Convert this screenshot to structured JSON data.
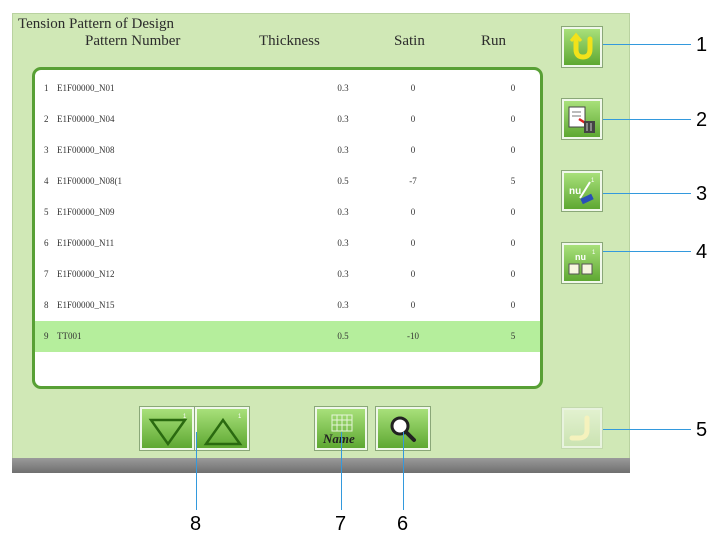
{
  "panel": {
    "title": "Tension Pattern of Design",
    "headers": {
      "pattern_number": "Pattern Number",
      "thickness": "Thickness",
      "satin": "Satin",
      "run": "Run"
    }
  },
  "rows": [
    {
      "index": "1",
      "name": "E1F00000_N01",
      "thickness": "0.3",
      "satin": "0",
      "run": "0"
    },
    {
      "index": "2",
      "name": "E1F00000_N04",
      "thickness": "0.3",
      "satin": "0",
      "run": "0"
    },
    {
      "index": "3",
      "name": "E1F00000_N08",
      "thickness": "0.3",
      "satin": "0",
      "run": "0"
    },
    {
      "index": "4",
      "name": "E1F00000_N08(1",
      "thickness": "0.5",
      "satin": "-7",
      "run": "5"
    },
    {
      "index": "5",
      "name": "E1F00000_N09",
      "thickness": "0.3",
      "satin": "0",
      "run": "0"
    },
    {
      "index": "6",
      "name": "E1F00000_N11",
      "thickness": "0.3",
      "satin": "0",
      "run": "0"
    },
    {
      "index": "7",
      "name": "E1F00000_N12",
      "thickness": "0.3",
      "satin": "0",
      "run": "0"
    },
    {
      "index": "8",
      "name": "E1F00000_N15",
      "thickness": "0.3",
      "satin": "0",
      "run": "0"
    },
    {
      "index": "9",
      "name": "TT001",
      "thickness": "0.5",
      "satin": "-10",
      "run": "5"
    }
  ],
  "selected_row_index": "9",
  "buttons": {
    "back": {
      "icon": "return-arrow-icon"
    },
    "delete": {
      "icon": "delete-trash-icon"
    },
    "edit": {
      "icon": "edit-pencil-icon"
    },
    "copy": {
      "icon": "copy-pattern-icon"
    },
    "confirm": {
      "icon": "return-arrow-icon",
      "state": "disabled"
    },
    "scroll_down": {
      "icon": "triangle-down-icon"
    },
    "scroll_up": {
      "icon": "triangle-up-icon"
    },
    "name": {
      "label": "Name",
      "icon": "name-grid-icon"
    },
    "search": {
      "icon": "magnifier-icon"
    }
  },
  "callouts": [
    "1",
    "2",
    "3",
    "4",
    "5",
    "6",
    "7",
    "8"
  ],
  "colors": {
    "panel": "#d0e8b6",
    "list_border": "#58a035",
    "selected_row": "#b5ee9c",
    "button": "#7cc449",
    "callout_line": "#3399dd"
  }
}
